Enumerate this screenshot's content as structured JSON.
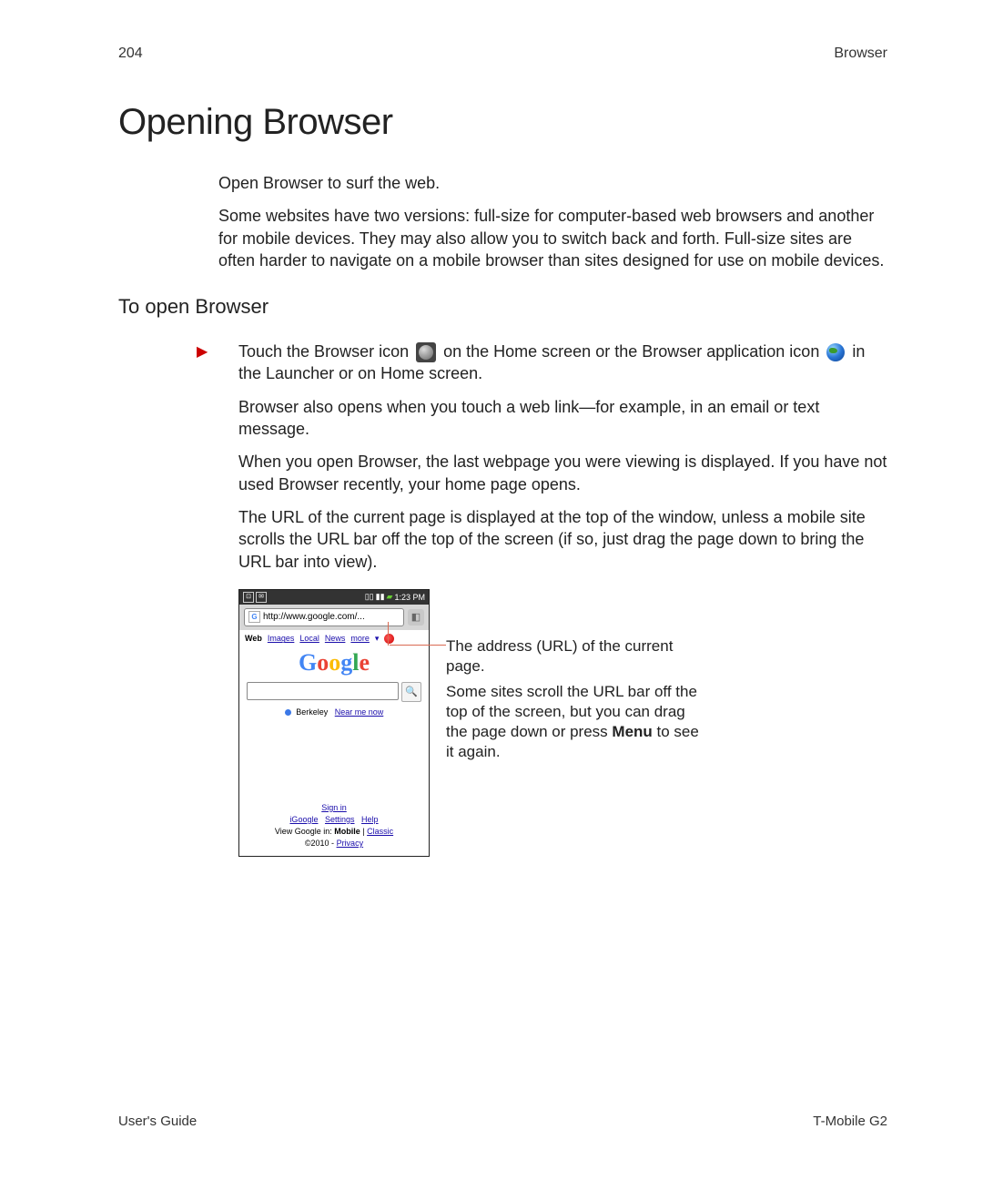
{
  "header": {
    "page_number": "204",
    "section": "Browser"
  },
  "title": "Opening Browser",
  "intro": {
    "p1": "Open Browser to surf the web.",
    "p2": "Some websites have two versions: full-size for computer-based web browsers and another for mobile devices. They may also allow you to switch back and forth. Full-size sites are often harder to navigate on a mobile browser than sites designed for use on mobile devices."
  },
  "subhead": "To open Browser",
  "steps": {
    "p1a": "Touch the Browser icon ",
    "p1b": " on the Home screen or the Browser application icon ",
    "p1c": " in the Launcher or on Home screen.",
    "p2": "Browser also opens when you touch a web link—for example, in an email or text message.",
    "p3": "When you open Browser, the last webpage you were viewing is displayed. If you have not used Browser recently, your home page opens.",
    "p4": "The URL of the current page is displayed at the top of the window, unless a mobile site scrolls the URL bar off the top of the screen (if so, just drag the page down to bring the URL bar into view)."
  },
  "screenshot": {
    "status_time": "1:23 PM",
    "url": "http://www.google.com/...",
    "nav": {
      "web": "Web",
      "images": "Images",
      "local": "Local",
      "news": "News",
      "more": "more"
    },
    "logo": {
      "l1": "G",
      "l2": "o",
      "l3": "o",
      "l4": "g",
      "l5": "l",
      "l6": "e"
    },
    "location_city": "Berkeley",
    "location_link": "Near me now",
    "signin": "Sign in",
    "links": {
      "igoogle": "iGoogle",
      "settings": "Settings",
      "help": "Help"
    },
    "view_label": "View Google in: ",
    "view_mobile": "Mobile",
    "view_sep": " | ",
    "view_classic": "Classic",
    "copyright_prefix": "©2010 - ",
    "copyright_link": "Privacy"
  },
  "callout": {
    "line1": "The address (URL) of the current page.",
    "line2a": "Some sites scroll the URL bar off the top of the screen, but you can drag the page down or press ",
    "line2_bold": "Menu",
    "line2b": " to see it again."
  },
  "footer": {
    "left": "User's Guide",
    "right": "T-Mobile G2"
  }
}
